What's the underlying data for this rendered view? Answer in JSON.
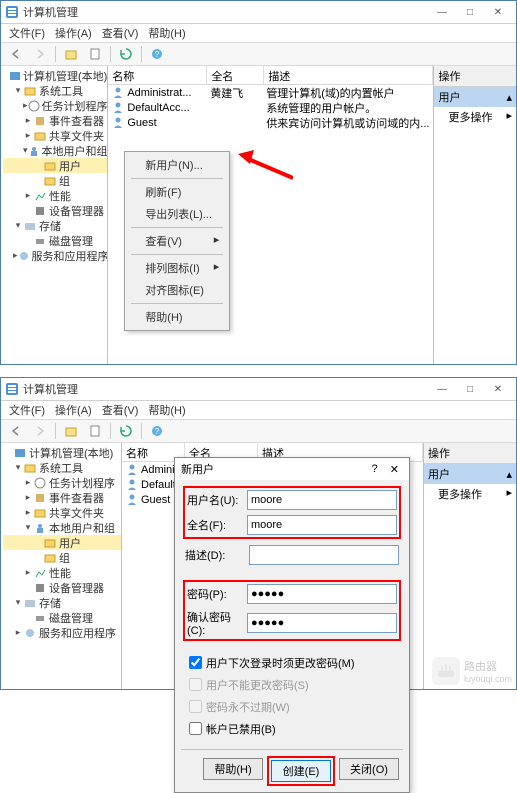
{
  "window_title": "计算机管理",
  "menubar": [
    "文件(F)",
    "操作(A)",
    "查看(V)",
    "帮助(H)"
  ],
  "win_controls": {
    "min": "—",
    "max": "□",
    "close": "✕"
  },
  "tree": {
    "root": "计算机管理(本地)",
    "sys_tools": "系统工具",
    "task_sched": "任务计划程序",
    "event_viewer": "事件查看器",
    "shared": "共享文件夹",
    "local_users": "本地用户和组",
    "users": "用户",
    "groups": "组",
    "perf": "性能",
    "devmgr": "设备管理器",
    "storage": "存储",
    "diskmgr": "磁盘管理",
    "services": "服务和应用程序"
  },
  "list": {
    "headers": [
      "名称",
      "全名",
      "描述"
    ],
    "rows": [
      {
        "name": "Administrat...",
        "full": "黄建飞",
        "desc": "管理计算机(域)的内置帐户"
      },
      {
        "name": "DefaultAcc...",
        "full": "",
        "desc": "系统管理的用户帐户。"
      },
      {
        "name": "Guest",
        "full": "",
        "desc": "供来宾访问计算机或访问域的内..."
      }
    ]
  },
  "list2": {
    "rows": [
      {
        "name": "Administr"
      },
      {
        "name": "DefaultAc"
      },
      {
        "name": "Guest"
      }
    ]
  },
  "context_menu": [
    "新用户(N)...",
    "刷新(F)",
    "导出列表(L)...",
    "查看(V)",
    "排列图标(I)",
    "对齐图标(E)",
    "帮助(H)"
  ],
  "actions": {
    "header": "操作",
    "selected": "用户",
    "more": "更多操作"
  },
  "dialog": {
    "title": "新用户",
    "help": "?",
    "close": "✕",
    "username_label": "用户名(U):",
    "username_value": "moore",
    "fullname_label": "全名(F):",
    "fullname_value": "moore",
    "desc_label": "描述(D):",
    "desc_value": "",
    "password_label": "密码(P):",
    "password_value": "●●●●●",
    "confirm_label": "确认密码(C):",
    "confirm_value": "●●●●●",
    "chk1": "用户下次登录时须更改密码(M)",
    "chk2": "用户不能更改密码(S)",
    "chk3": "密码永不过期(W)",
    "chk4": "帐户已禁用(B)",
    "btn_help": "帮助(H)",
    "btn_create": "创建(E)",
    "btn_close": "关闭(O)"
  },
  "watermark": {
    "text1": "路由器",
    "text2": "luyouqi.com"
  }
}
